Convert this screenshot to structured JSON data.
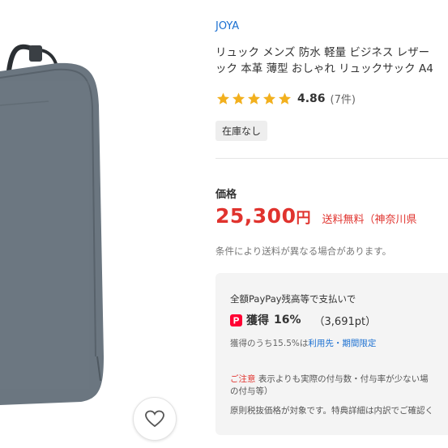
{
  "product": {
    "brand": "JOYA",
    "title_line1": "リュック メンズ 防水 軽量 ビジネス レザー",
    "title_line2": "ック 本革 薄型 おしゃれ リュックサック A4",
    "image_icon": "backpack-photo"
  },
  "rating": {
    "stars": 5,
    "score": "4.86",
    "reviews": "(7件)",
    "star_color": "#f2b01e"
  },
  "stock": {
    "label": "在庫なし"
  },
  "price": {
    "label": "価格",
    "amount": "25,300",
    "unit": "円",
    "shipping": "送料無料（神奈川県",
    "note": "条件により送料が異なる場合があります。",
    "color": "#e0332e"
  },
  "points": {
    "header": "全額PayPay残高等で支払いで",
    "icon": "paypay-icon",
    "earn_label": "獲得",
    "earn_rate": "16%",
    "earn_points": "（3,691pt）",
    "breakdown_prefix": "獲得のうち15.5%は",
    "breakdown_link": "利用先・期間限定",
    "caution_label": "ご注意",
    "caution_line1": " 表示よりも実際の付与数・付与率が少ない場",
    "caution_line2": "の付与等）",
    "footer": "原則税抜価格が対象です。特典詳細は内訳でご確認く"
  },
  "favorite": {
    "icon": "heart-icon"
  }
}
